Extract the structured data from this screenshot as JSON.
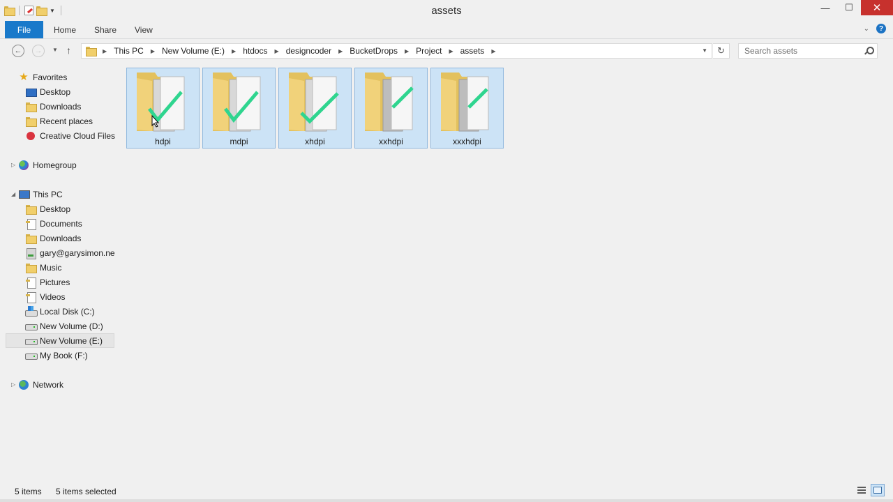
{
  "window": {
    "title": "assets",
    "minimize": "—",
    "maximize": "☐",
    "close": "✕"
  },
  "ribbon": {
    "tabs": [
      "File",
      "Home",
      "Share",
      "View"
    ],
    "help": "?"
  },
  "navigation": {
    "breadcrumb": [
      "This PC",
      "New Volume (E:)",
      "htdocs",
      "designcoder",
      "BucketDrops",
      "Project",
      "assets"
    ],
    "search_placeholder": "Search assets"
  },
  "sidebar": {
    "favorites": {
      "label": "Favorites",
      "items": [
        "Desktop",
        "Downloads",
        "Recent places",
        "Creative Cloud Files"
      ]
    },
    "homegroup": {
      "label": "Homegroup"
    },
    "this_pc": {
      "label": "This PC",
      "items": [
        "Desktop",
        "Documents",
        "Downloads",
        "gary@garysimon.ne",
        "Music",
        "Pictures",
        "Videos",
        "Local Disk (C:)",
        "New Volume (D:)",
        "New Volume (E:)",
        "My Book (F:)"
      ],
      "selected": "New Volume (E:)"
    },
    "network": {
      "label": "Network"
    }
  },
  "content": {
    "folders": [
      "hdpi",
      "mdpi",
      "xhdpi",
      "xxhdpi",
      "xxxhdpi"
    ]
  },
  "status": {
    "item_count": "5 items",
    "selection": "5 items selected"
  },
  "colors": {
    "accent": "#1979ca",
    "selection_fill": "#cce3f6",
    "selection_border": "#8fb8de",
    "close_button": "#c7312d",
    "check_green": "#2fd58f"
  }
}
